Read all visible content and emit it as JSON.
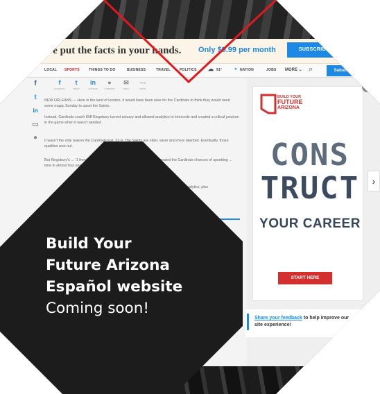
{
  "banner": {
    "headline": "We put the facts in your hands.",
    "offer": "Only $9.99 per month",
    "button": "SUBSCRIBE NOW"
  },
  "nav": {
    "logo": "tral.",
    "items": [
      "LOCAL",
      "SPORTS",
      "THINGS TO DO",
      "BUSINESS",
      "TRAVEL",
      "POLITICS"
    ],
    "weather": "91°",
    "nation": "NATION",
    "jobs": "JOBS",
    "more": "MORE",
    "subscribe": "Subscribe",
    "sign_in": "Sign"
  },
  "share_row": [
    {
      "glyph": "f",
      "label": "FACEBOOK"
    },
    {
      "glyph": "t",
      "label": "TWEET"
    },
    {
      "glyph": "in",
      "label": "LINKEDIN"
    },
    {
      "glyph": "●",
      "label": "COMMENT"
    },
    {
      "glyph": "✉",
      "label": "EMAIL"
    },
    {
      "glyph": "⋯",
      "label": "MORE"
    }
  ],
  "article": {
    "p1": "NEW ORLEANS — Here in the land of voodoo, it would have been wise for the Cardinals to think they would need some magic Sunday to upset the Saints.",
    "p2": "Instead, Cardinals coach Kliff Kingsbury turned actuary and allowed analytics to intercede and created a critical juncture in the game when it wasn't needed.",
    "p3": "It wasn't the only reason the Cardinals lost, 31-9. The Saints are older, wiser and more talented. Eventually, those qualities won out.",
    "p4": "But Kingsbury's ... -1 from his own 30-yard line with 7 ½ minutes left ... sealed the Cardinals chances of upsetting ... time in almost four years.",
    "p5": "\"No ... difficult. \"The analytics, plus",
    "link": "today"
  },
  "ad": {
    "tag1": "BUILD YOUR",
    "tag2": "FUTURE",
    "tag3": "ARIZONA",
    "line1": "CONS",
    "line2": "TRUCT",
    "line3": "YOUR CAREER",
    "button": "START HERE",
    "close": "×"
  },
  "feedback": {
    "link": "Share your feedback",
    "rest": " to help improve our site experience!"
  },
  "arrow": "›",
  "callout": {
    "line1": "Build Your",
    "line2": "Future Arizona",
    "line3": "Español website",
    "line4": "Coming soon!"
  },
  "colors": {
    "accent_blue": "#1e88e5",
    "accent_red": "#d32f2f",
    "callout_bg": "#1c1c1c"
  }
}
